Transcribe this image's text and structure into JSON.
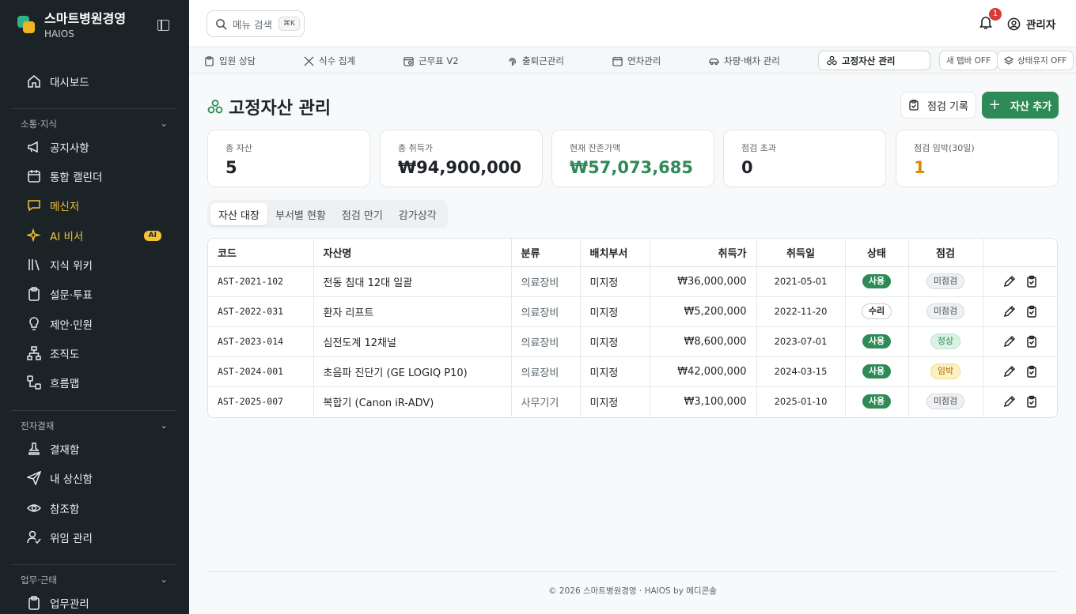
{
  "sidebar": {
    "brand_title": "스마트병원경영",
    "brand_sub": "HAIOS",
    "dashboard": "대시보드",
    "section1": "소통·지식",
    "items1": [
      "공지사항",
      "통합 캘린더",
      "메신저",
      "AI 비서",
      "지식 위키",
      "설문·투표",
      "제안·민원",
      "조직도",
      "흐름맵"
    ],
    "ai_badge": "AI",
    "section2": "전자결재",
    "items2": [
      "결재함",
      "내 상신함",
      "참조함",
      "위임 관리"
    ],
    "section3": "업무·근태",
    "items3": [
      "업무관리"
    ],
    "accent": "#f2c335"
  },
  "topbar": {
    "search_placeholder": "메뉴 검색",
    "shortcut": "⌘K",
    "notification_count": "1",
    "user": "관리자"
  },
  "tabs": [
    "입원 상담",
    "식수 집계",
    "근무표 V2",
    "출퇴근관리",
    "연차관리",
    "차량·배차 관리",
    "고정자산 관리"
  ],
  "tab_pills": [
    "새 탭바 OFF",
    "상태유지 OFF"
  ],
  "page": {
    "title": "고정자산 관리",
    "btn_inspect": "점검 기록",
    "btn_add": "자산 추가"
  },
  "stats": [
    {
      "label": "총 자산",
      "value": "5",
      "color": "#1f2328"
    },
    {
      "label": "총 취득가",
      "value": "₩94,900,000",
      "color": "#1f2328"
    },
    {
      "label": "현재 잔존가액",
      "value": "₩57,073,685",
      "color": "#2e8b57"
    },
    {
      "label": "점검 초과",
      "value": "0",
      "color": "#1f2328"
    },
    {
      "label": "점검 임박(30일)",
      "value": "1",
      "color": "#d98a0b"
    }
  ],
  "subtabs": [
    "자산 대장",
    "부서별 현황",
    "점검 만기",
    "감가상각"
  ],
  "table": {
    "headers": [
      "코드",
      "자산명",
      "분류",
      "배치부서",
      "취득가",
      "취득일",
      "상태",
      "점검",
      ""
    ],
    "rows": [
      {
        "code": "AST-2021-102",
        "name": "전동 침대 12대 일괄",
        "category": "의료장비",
        "dept": "미지정",
        "price": "₩36,000,000",
        "date": "2021-05-01",
        "status": "사용",
        "inspect": "미점검"
      },
      {
        "code": "AST-2022-031",
        "name": "환자 리프트",
        "category": "의료장비",
        "dept": "미지정",
        "price": "₩5,200,000",
        "date": "2022-11-20",
        "status": "수리",
        "inspect": "미점검"
      },
      {
        "code": "AST-2023-014",
        "name": "심전도계 12채널",
        "category": "의료장비",
        "dept": "미지정",
        "price": "₩8,600,000",
        "date": "2023-07-01",
        "status": "사용",
        "inspect": "정상"
      },
      {
        "code": "AST-2024-001",
        "name": "초음파 진단기 (GE LOGIQ P10)",
        "category": "의료장비",
        "dept": "미지정",
        "price": "₩42,000,000",
        "date": "2024-03-15",
        "status": "사용",
        "inspect": "임박"
      },
      {
        "code": "AST-2025-007",
        "name": "복합기 (Canon iR-ADV)",
        "category": "사무기기",
        "dept": "미지정",
        "price": "₩3,100,000",
        "date": "2025-01-10",
        "status": "사용",
        "inspect": "미점검"
      }
    ]
  },
  "footer": "© 2026 스마트병원경영 · HAIOS by 메디콘솔"
}
